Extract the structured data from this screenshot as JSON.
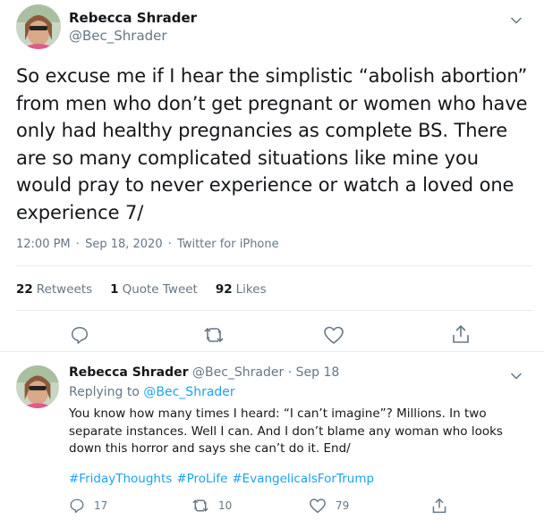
{
  "main_tweet": {
    "author_name": "Rebecca Shrader",
    "author_handle": "@Bec_Shrader",
    "text": "So excuse me if I hear the simplistic “abolish abortion” from men who don’t get pregnant or women who have only had healthy pregnancies as complete BS. There are so many complicated situations like mine you would pray to never experience or watch a loved one experience 7/",
    "time": "12:00 PM",
    "date": "Sep 18, 2020",
    "source": "Twitter for iPhone",
    "stats": {
      "retweets_count": "22",
      "retweets_label": "Retweets",
      "quote_count": "1",
      "quote_label": "Quote Tweet",
      "likes_count": "92",
      "likes_label": "Likes"
    },
    "icons": [
      "reply-icon",
      "retweet-icon",
      "like-icon",
      "share-icon",
      "chevron-down-icon"
    ]
  },
  "reply_tweet": {
    "author_name": "Rebecca Shrader",
    "author_handle": "@Bec_Shrader",
    "date": "Sep 18",
    "replying_prefix": "Replying to",
    "replying_to": "@Bec_Shrader",
    "text": "You know how many times I heard: “I can’t imagine”? Millions. In two separate instances. Well I can. And I don’t blame any woman who looks down this horror and says she can’t do it. End/",
    "hashtags": [
      "#FridayThoughts",
      "#ProLife",
      "#EvangelicalsForTrump"
    ],
    "reply_count": "17",
    "retweet_count": "10",
    "like_count": "79"
  },
  "separator": "·",
  "colors": {
    "link": "#1da1f2",
    "muted": "#657786",
    "text": "#14171a",
    "divider": "#e6ecf0"
  }
}
